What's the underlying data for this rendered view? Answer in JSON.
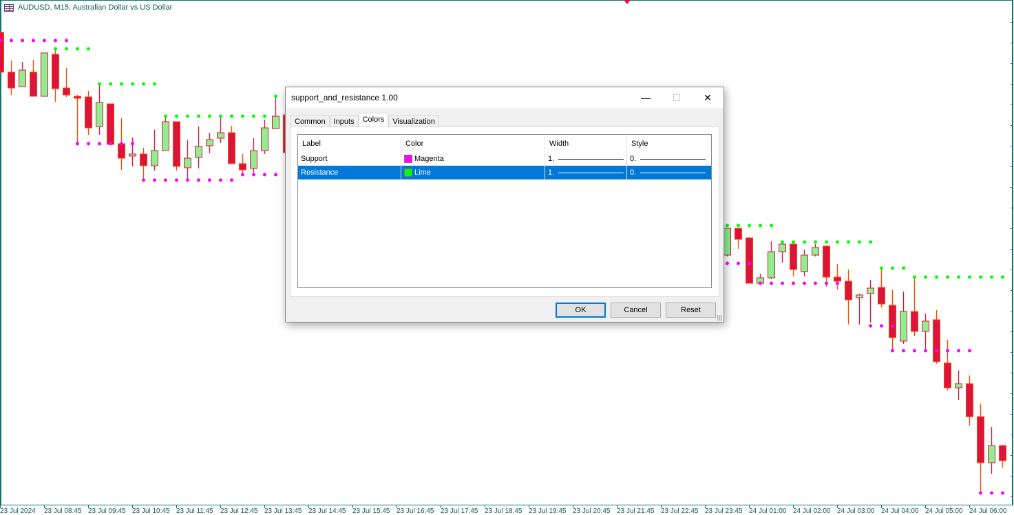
{
  "chart": {
    "symbol_title": "AUDUSD, M15:  Australian Dollar vs US Dollar",
    "colors": {
      "bull": "#90ee90",
      "bear": "#dc143c",
      "wick_bear": "#ff4500",
      "wick_bull": "#dc143c",
      "support": "#ff00ff",
      "resistance": "#00ff00",
      "axis": "#0d7373"
    },
    "time_labels": [
      "23 Jul 2024",
      "23 Jul 08:45",
      "23 Jul 09:45",
      "23 Jul 10:45",
      "23 Jul 11:45",
      "23 Jul 12:45",
      "23 Jul 13:45",
      "23 Jul 14:45",
      "23 Jul 15:45",
      "23 Jul 16:45",
      "23 Jul 17:45",
      "23 Jul 18:45",
      "23 Jul 19:45",
      "23 Jul 20:45",
      "23 Jul 21:45",
      "23 Jul 22:45",
      "23 Jul 23:45",
      "24 Jul 01:00",
      "24 Jul 02:00",
      "24 Jul 03:00",
      "24 Jul 04:00",
      "24 Jul 05:00",
      "24 Jul 06:00"
    ]
  },
  "chart_data": {
    "type": "candlestick",
    "title": "AUDUSD, M15",
    "price_base": 0.66,
    "point": 1e-05,
    "candles_ohlc_points": [
      [
        0,
        703,
        703,
        645,
        645
      ],
      [
        1,
        645,
        662,
        612,
        622
      ],
      [
        2,
        624,
        660,
        624,
        648
      ],
      [
        3,
        645,
        663,
        610,
        610
      ],
      [
        4,
        610,
        673,
        610,
        673
      ],
      [
        5,
        671,
        678,
        602,
        621
      ],
      [
        6,
        622,
        651,
        609,
        612
      ],
      [
        7,
        610,
        612,
        541,
        607
      ],
      [
        8,
        609,
        618,
        554,
        564
      ],
      [
        9,
        566,
        628,
        554,
        601
      ],
      [
        10,
        599,
        599,
        540,
        540
      ],
      [
        11,
        541,
        578,
        503,
        520
      ],
      [
        12,
        523,
        550,
        508,
        526
      ],
      [
        13,
        526,
        535,
        488,
        509
      ],
      [
        14,
        509,
        561,
        502,
        531
      ],
      [
        15,
        531,
        581,
        531,
        573
      ],
      [
        16,
        573,
        573,
        502,
        508
      ],
      [
        17,
        506,
        546,
        489,
        520
      ],
      [
        18,
        521,
        566,
        505,
        537
      ],
      [
        19,
        538,
        557,
        527,
        547
      ],
      [
        20,
        549,
        582,
        542,
        557
      ],
      [
        21,
        557,
        567,
        512,
        512
      ],
      [
        22,
        512,
        526,
        496,
        503
      ],
      [
        23,
        505,
        549,
        499,
        531
      ],
      [
        24,
        531,
        576,
        526,
        564
      ],
      [
        25,
        563,
        610,
        563,
        581
      ],
      [
        26,
        583,
        590,
        528,
        528
      ],
      [
        66,
        379,
        418,
        377,
        418
      ],
      [
        67,
        418,
        418,
        388,
        402
      ],
      [
        68,
        404,
        405,
        338,
        338
      ],
      [
        69,
        338,
        352,
        338,
        346
      ],
      [
        70,
        346,
        399,
        344,
        384
      ],
      [
        71,
        384,
        399,
        368,
        395
      ],
      [
        72,
        395,
        399,
        348,
        358
      ],
      [
        73,
        355,
        387,
        348,
        379
      ],
      [
        74,
        379,
        395,
        377,
        390
      ],
      [
        75,
        392,
        393,
        333,
        347
      ],
      [
        76,
        347,
        366,
        329,
        341
      ],
      [
        77,
        341,
        358,
        278,
        314
      ],
      [
        78,
        317,
        323,
        278,
        321
      ],
      [
        79,
        323,
        343,
        281,
        331
      ],
      [
        80,
        332,
        362,
        303,
        308
      ],
      [
        81,
        306,
        328,
        241,
        259
      ],
      [
        82,
        254,
        326,
        250,
        297
      ],
      [
        83,
        297,
        347,
        261,
        268
      ],
      [
        84,
        268,
        294,
        243,
        283
      ],
      [
        85,
        285,
        299,
        221,
        224
      ],
      [
        86,
        222,
        256,
        182,
        186
      ],
      [
        87,
        186,
        211,
        168,
        192
      ],
      [
        88,
        192,
        204,
        131,
        144
      ],
      [
        89,
        144,
        163,
        33,
        77
      ],
      [
        90,
        77,
        129,
        61,
        102
      ],
      [
        91,
        102,
        103,
        70,
        80
      ]
    ],
    "support_levels": [
      [
        0,
        6,
        691
      ],
      [
        7,
        12,
        541
      ],
      [
        13,
        21,
        488
      ],
      [
        22,
        25,
        496
      ],
      [
        66,
        68,
        367
      ],
      [
        69,
        76,
        338
      ],
      [
        79,
        81,
        276
      ],
      [
        81,
        88,
        240
      ],
      [
        89,
        91,
        33
      ]
    ],
    "resistance_levels": [
      [
        5,
        8,
        679
      ],
      [
        9,
        14,
        628
      ],
      [
        15,
        24,
        581
      ],
      [
        25,
        25,
        610
      ],
      [
        66,
        70,
        422
      ],
      [
        71,
        79,
        398
      ],
      [
        80,
        82,
        360
      ],
      [
        83,
        91,
        347
      ]
    ]
  },
  "dialog": {
    "title": "support_and_resistance 1.00",
    "tabs": [
      "Common",
      "Inputs",
      "Colors",
      "Visualization"
    ],
    "active_tab": "Colors",
    "columns": [
      "Label",
      "Color",
      "Width",
      "Style"
    ],
    "rows": [
      {
        "label": "Support",
        "color_name": "Magenta",
        "color": "#ff00ff",
        "width": "1.",
        "style": "0.",
        "selected": false
      },
      {
        "label": "Resistance",
        "color_name": "Lime",
        "color": "#00ff00",
        "width": "1.",
        "style": "0.",
        "selected": true
      }
    ],
    "buttons": {
      "ok": "OK",
      "cancel": "Cancel",
      "reset": "Reset"
    },
    "window": {
      "minimize": "—",
      "maximize": "☐",
      "close": "✕"
    }
  }
}
